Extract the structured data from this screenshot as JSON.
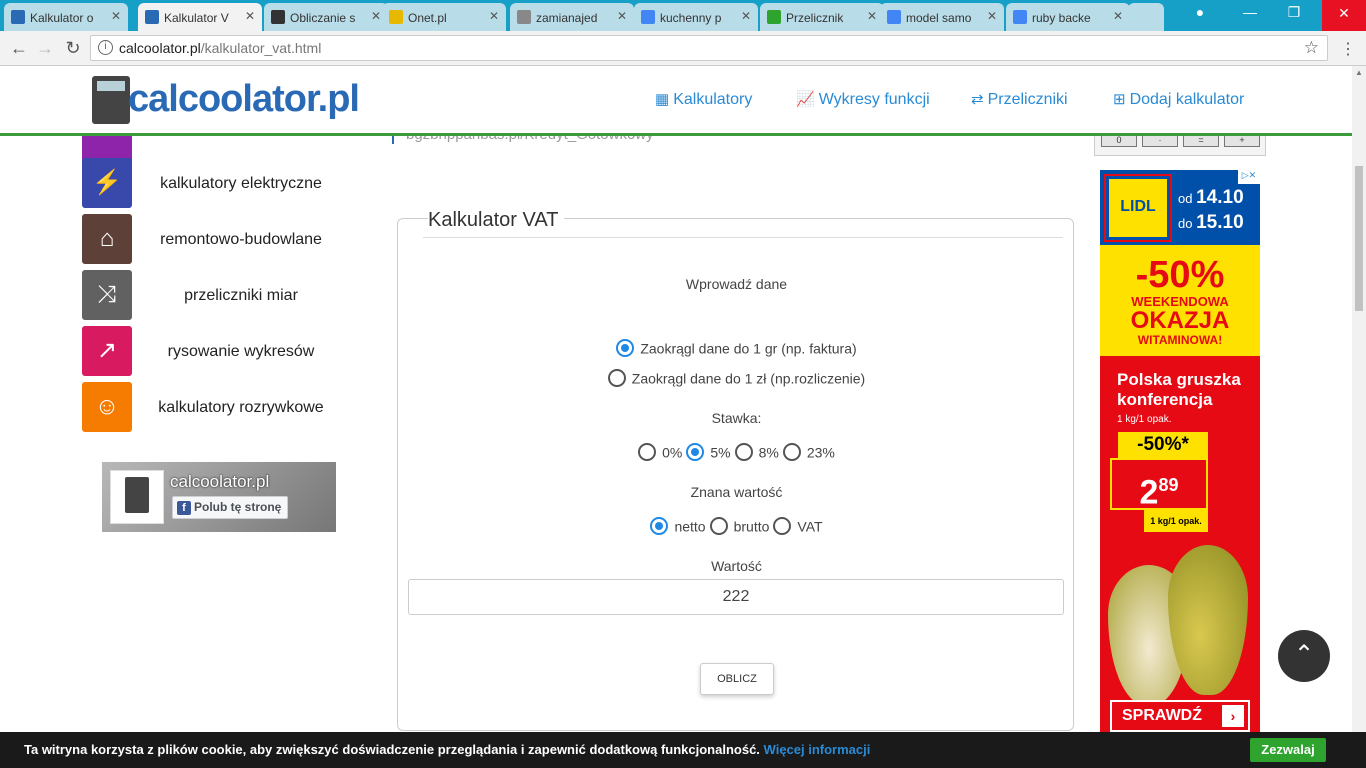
{
  "browser": {
    "tabs": [
      {
        "label": "Kalkulator o",
        "icon_color": "#2a6ab5",
        "active": false
      },
      {
        "label": "Kalkulator V",
        "icon_color": "#2a6ab5",
        "active": true
      },
      {
        "label": "Obliczanie s",
        "icon_color": "#333333",
        "active": false
      },
      {
        "label": "Onet.pl",
        "icon_color": "#e6b800",
        "active": false
      },
      {
        "label": "zamianajed",
        "icon_color": "#888888",
        "active": false
      },
      {
        "label": "kuchenny p",
        "icon_color": "#4285f4",
        "active": false
      },
      {
        "label": "Przelicznik",
        "icon_color": "#2ea32e",
        "active": false
      },
      {
        "label": "model samo",
        "icon_color": "#4285f4",
        "active": false
      },
      {
        "label": "ruby backe",
        "icon_color": "#4285f4",
        "active": false
      }
    ],
    "url_domain": "calcoolator.pl",
    "url_path": "/kalkulator_vat.html"
  },
  "header": {
    "logo_text": "calcoolator.pl",
    "nav": [
      {
        "icon": "table-icon",
        "glyph": "▦",
        "label": "Kalkulatory"
      },
      {
        "icon": "chart-icon",
        "glyph": "📈",
        "label": "Wykresy funkcji"
      },
      {
        "icon": "shuffle-icon",
        "glyph": "⇄",
        "label": "Przeliczniki"
      },
      {
        "icon": "plus-square-icon",
        "glyph": "⊞",
        "label": "Dodaj kalkulator"
      }
    ]
  },
  "sidebar": {
    "items": [
      {
        "label": "kalkulatory elektryczne",
        "icon": "lightning-icon",
        "glyph": "⚡",
        "color": "#3949ab"
      },
      {
        "label": "remontowo-budowlane",
        "icon": "home-icon",
        "glyph": "⌂",
        "color": "#5d4037"
      },
      {
        "label": "przeliczniki miar",
        "icon": "shuffle-icon",
        "glyph": "⤨",
        "color": "#616161"
      },
      {
        "label": "rysowanie wykresów",
        "icon": "trend-icon",
        "glyph": "↗",
        "color": "#d81b60"
      },
      {
        "label": "kalkulatory rozrywkowe",
        "icon": "smile-icon",
        "glyph": "☺",
        "color": "#f57c00"
      }
    ],
    "fb": {
      "name": "calcoolator.pl",
      "like": "Polub tę stronę"
    }
  },
  "main": {
    "gray_text": "bgzbnpparibas.pl/Kredyt_Gotowkowy",
    "calculator": {
      "title": "Kalkulator VAT",
      "intro": "Wprowadź dane",
      "rounding": [
        {
          "label": "Zaokrągl dane do 1 gr (np. faktura)",
          "selected": true
        },
        {
          "label": "Zaokrągl dane do 1 zł (np.rozliczenie)",
          "selected": false
        }
      ],
      "rate_label": "Stawka:",
      "rates": [
        {
          "label": "0%",
          "selected": false
        },
        {
          "label": "5%",
          "selected": true
        },
        {
          "label": "8%",
          "selected": false
        },
        {
          "label": "23%",
          "selected": false
        }
      ],
      "known_label": "Znana wartość",
      "known": [
        {
          "label": "netto",
          "selected": true
        },
        {
          "label": "brutto",
          "selected": false
        },
        {
          "label": "VAT",
          "selected": false
        }
      ],
      "value_label": "Wartość",
      "value": "222",
      "button": "OBLICZ"
    },
    "keypad": [
      "0",
      "·",
      "=",
      "+"
    ]
  },
  "ad": {
    "brand": "LIDL",
    "date_from_prefix": "od",
    "date_from": "14.10",
    "date_to_prefix": "do",
    "date_to": "15.10",
    "promo_pct": "-50%",
    "promo_line1": "WEEKENDOWA",
    "promo_line2": "OKAZJA",
    "promo_line3": "WITAMINOWA!",
    "product": "Polska gruszka konferencja",
    "unit": "1 kg/1 opak.",
    "discount": "-50%*",
    "price_main": "2",
    "price_cents": "89",
    "pack": "1 kg/1 opak.",
    "cta": "SPRAWDŹ"
  },
  "cookie": {
    "message": "Ta witryna korzysta z plików cookie, aby zwiększyć doświadczenie przeglądania i zapewnić dodatkową funkcjonalność.",
    "more": "Więcej informacji",
    "accept": "Zezwalaj"
  }
}
